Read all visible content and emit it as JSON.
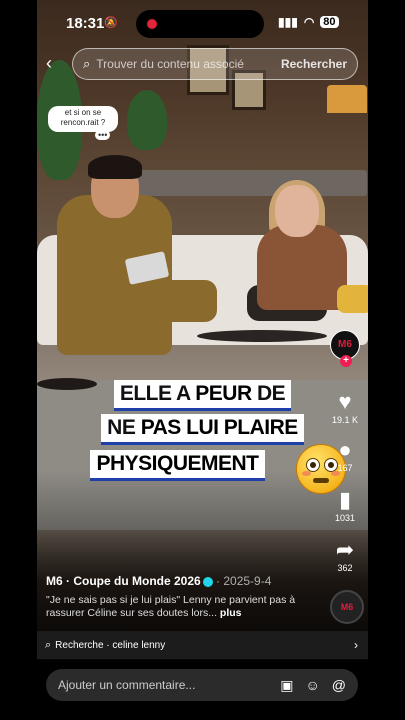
{
  "status": {
    "time": "18:31",
    "bell_muted_icon": "bell-slash-icon",
    "battery": "80"
  },
  "search": {
    "placeholder": "Trouver du contenu associé",
    "button": "Rechercher"
  },
  "bubble": {
    "text": "et si on se rencon.rait ?",
    "dots": "•••"
  },
  "caption": {
    "line1": {
      "pre": "ELLE A ",
      "hl": "PEUR",
      "post": " DE"
    },
    "line2": {
      "pre": "NE ",
      "hl": "PAS LUI PLAIRE",
      "post": ""
    },
    "line3": {
      "pre": "",
      "hl": "PHYSIQUEMENT",
      "post": ""
    },
    "emoji": "flushed-face"
  },
  "rail": {
    "avatar_label": "M6",
    "likes": "19.1 K",
    "comments": "167",
    "saves": "1031",
    "shares": "362"
  },
  "meta": {
    "author": "M6 · Coupe du Monde 2026",
    "date": " · 2025-9-4",
    "desc": "\"Je ne sais pas si je lui plais\" Lenny ne parvient pas à rassurer Céline sur ses doutes lors...",
    "more": " plus"
  },
  "related": {
    "text": "Recherche · celine lenny"
  },
  "comment": {
    "placeholder": "Ajouter un commentaire..."
  }
}
